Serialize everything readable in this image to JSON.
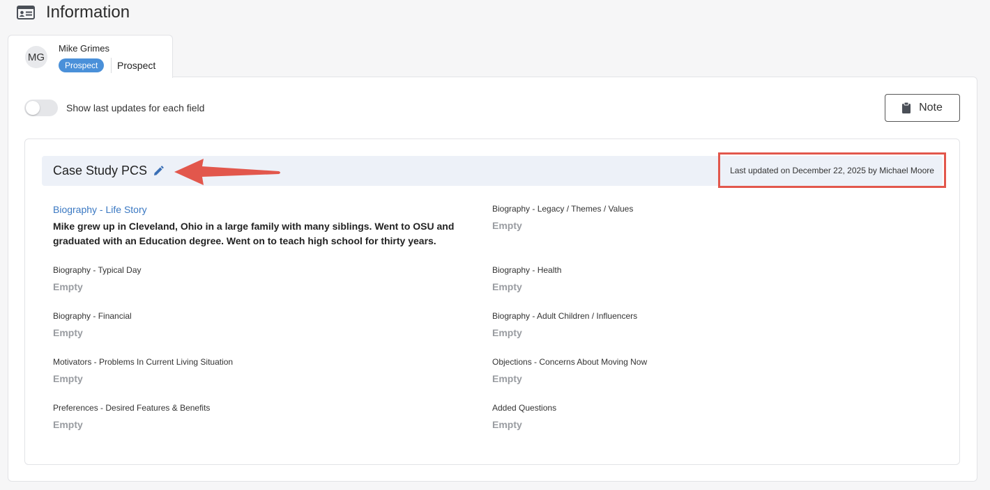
{
  "header": {
    "title": "Information",
    "icon": "id-card-icon"
  },
  "contact": {
    "initials": "MG",
    "name": "Mike Grimes",
    "badge": "Prospect",
    "type": "Prospect",
    "badge_color": "#4a90d9"
  },
  "controls": {
    "toggle_label": "Show last updates for each field",
    "toggle_on": false,
    "note_label": "Note",
    "note_icon": "clipboard-icon"
  },
  "section": {
    "title": "Case Study PCS",
    "edit_icon": "pencil-icon",
    "last_updated": "Last updated on December 22, 2025 by Michael Moore"
  },
  "annotation": {
    "arrow_color": "#e2574c",
    "highlight_color": "#e2574c"
  },
  "fields": [
    {
      "label": "Biography - Life Story",
      "value": "Mike grew up in Cleveland, Ohio in a large family with many siblings. Went to OSU and graduated with an Education degree. Went on to teach high school for thirty years."
    },
    {
      "label": "Biography - Legacy / Themes / Values",
      "value": "Empty"
    },
    {
      "label": "Biography - Typical Day",
      "value": "Empty"
    },
    {
      "label": "Biography - Health",
      "value": "Empty"
    },
    {
      "label": "Biography - Financial",
      "value": "Empty"
    },
    {
      "label": "Biography - Adult Children / Influencers",
      "value": "Empty"
    },
    {
      "label": "Motivators - Problems In Current Living Situation",
      "value": "Empty"
    },
    {
      "label": "Objections - Concerns About Moving Now",
      "value": "Empty"
    },
    {
      "label": "Preferences - Desired Features & Benefits",
      "value": "Empty"
    },
    {
      "label": "Added Questions",
      "value": "Empty"
    }
  ]
}
